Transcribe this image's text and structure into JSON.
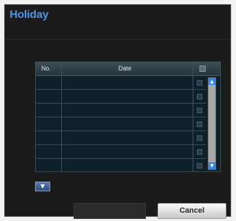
{
  "dialog": {
    "title": "Holiday",
    "table": {
      "columns": [
        "No.",
        "Date"
      ],
      "rows": [
        {
          "no": "",
          "date": "",
          "checked": false
        },
        {
          "no": "",
          "date": "",
          "checked": false
        },
        {
          "no": "",
          "date": "",
          "checked": false
        },
        {
          "no": "",
          "date": "",
          "checked": false
        },
        {
          "no": "",
          "date": "",
          "checked": false
        },
        {
          "no": "",
          "date": "",
          "checked": false
        },
        {
          "no": "",
          "date": "",
          "checked": false
        }
      ]
    },
    "scrollbar": {
      "up_icon": "▲",
      "down_icon": "▼"
    },
    "add_button": {
      "icon": "▼"
    },
    "ok_label": "",
    "cancel_label": "Cancel"
  }
}
